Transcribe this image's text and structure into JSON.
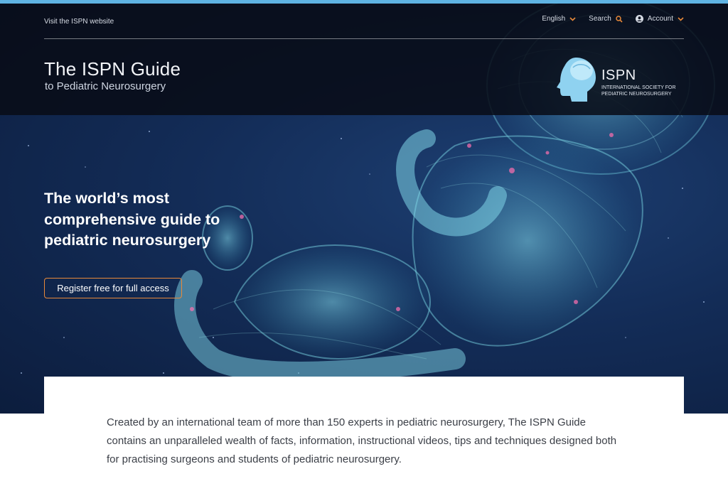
{
  "header": {
    "visit_link": "Visit the ISPN website",
    "language": "English",
    "search": "Search",
    "account": "Account",
    "title": "The ISPN Guide",
    "subtitle": "to Pediatric Neurosurgery"
  },
  "logo": {
    "name": "ISPN",
    "tagline_line1": "International Society for",
    "tagline_line2": "Pediatric Neurosurgery"
  },
  "hero": {
    "headline": "The world’s most comprehensive guide to pediatric neurosurgery",
    "cta_label": "Register free for full access"
  },
  "intro": {
    "text": "Created by an international team of more than 150 experts in pediatric neurosurgery, The ISPN Guide contains an unparalleled wealth of facts, information, instructional videos, tips and techniques designed both for practising surgeons and students of pediatric neurosurgery."
  },
  "colors": {
    "accent": "#e8893a",
    "top_stripe": "#5fb3e3",
    "hero_bg": "#132c57"
  },
  "icons": [
    "chevron-down-icon",
    "search-icon",
    "user-icon",
    "ispn-head-logo"
  ]
}
